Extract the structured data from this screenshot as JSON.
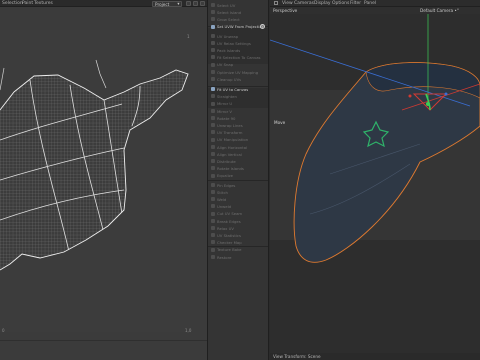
{
  "uv_editor": {
    "menu": [
      "Selection",
      "Paint",
      "Textures"
    ],
    "projection_dropdown": "Project",
    "corner_labels": {
      "top_right": "1",
      "bottom_left": "0",
      "bottom_right": "1,0"
    }
  },
  "tool_strip": {
    "items": [
      {
        "label": "Select UV"
      },
      {
        "label": "Select Island"
      },
      {
        "label": "Grow Select"
      },
      {
        "label": "Set UVW From Projection",
        "active": true,
        "has_gear": true
      },
      {
        "label": "UV Unwrap"
      },
      {
        "label": "UV Relax Settings"
      },
      {
        "label": "Pack Islands"
      },
      {
        "label": "Fit Selection To Canvas"
      },
      {
        "label": "UV Snap"
      },
      {
        "label": "Optimize UV Mapping"
      },
      {
        "label": "Cleanup UVs"
      },
      {
        "label": "Fit UV to Canvas",
        "active": true
      },
      {
        "label": "Straighten"
      },
      {
        "label": "Mirror U"
      },
      {
        "label": "Mirror V"
      },
      {
        "label": "Rotate 90"
      },
      {
        "label": "Unwrap Lines"
      },
      {
        "label": "UV Transform"
      },
      {
        "label": "UV Manipulation"
      },
      {
        "label": "Align Horizontal"
      },
      {
        "label": "Align Vertical"
      },
      {
        "label": "Distribute"
      },
      {
        "label": "Rotate Islands"
      },
      {
        "label": "Equalize"
      },
      {
        "label": "Pin Edges"
      },
      {
        "label": "Stitch"
      },
      {
        "label": "Weld"
      },
      {
        "label": "Unweld"
      },
      {
        "label": "Cut UV Seam"
      },
      {
        "label": "Break Edges"
      },
      {
        "label": "Relax UV"
      },
      {
        "label": "UV Statistics"
      },
      {
        "label": "Checker Map"
      },
      {
        "label": "Texture Bake"
      },
      {
        "label": "Restore"
      }
    ]
  },
  "viewport": {
    "menu": [
      "View",
      "Cameras",
      "Display",
      "Options",
      "Filter",
      "Panel"
    ],
    "perspective_label": "Perspective",
    "camera_label": "Default Camera •°",
    "move_label": "Move",
    "footer_label": "View Transform: Scene"
  },
  "colors": {
    "selection_outline": "#e07a2f",
    "axis_x": "#d23a32",
    "axis_y": "#3ccd56",
    "axis_z": "#3a6fd6",
    "hat_fabric": "#2e3845"
  }
}
